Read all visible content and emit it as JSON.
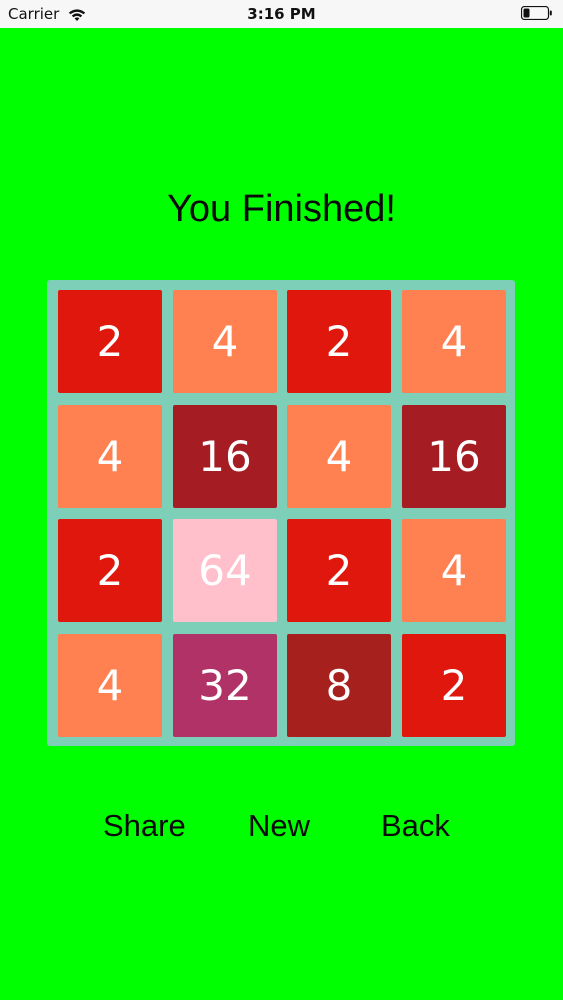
{
  "status_bar": {
    "carrier": "Carrier",
    "time": "3:16 PM"
  },
  "title": "You Finished!",
  "board": {
    "tiles": [
      [
        "2",
        "4",
        "2",
        "4"
      ],
      [
        "4",
        "16",
        "4",
        "16"
      ],
      [
        "2",
        "64",
        "2",
        "4"
      ],
      [
        "4",
        "32",
        "8",
        "2"
      ]
    ],
    "colors": {
      "2": "#e0170d",
      "4": "#ff8050",
      "8": "#a6211d",
      "16": "#a51c22",
      "32": "#b13266",
      "64": "#ffc0cb"
    },
    "background": "#7ecfb7"
  },
  "actions": {
    "share_label": "Share",
    "new_label": "New",
    "back_label": "Back"
  },
  "colors": {
    "background": "#00ff00",
    "status_bar": "#f7f7f7"
  }
}
